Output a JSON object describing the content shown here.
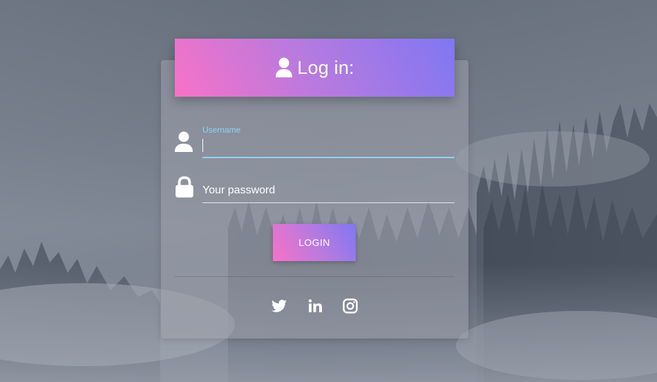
{
  "login_form": {
    "title": "Log in:",
    "header_icon": "user-icon",
    "username": {
      "label": "Username",
      "value": "",
      "icon": "user-icon"
    },
    "password": {
      "placeholder": "Your password",
      "value": "",
      "icon": "lock-icon"
    },
    "submit_label": "LOGIN"
  },
  "social_links": [
    {
      "icon": "twitter-icon"
    },
    {
      "icon": "linkedin-icon"
    },
    {
      "icon": "instagram-icon"
    }
  ],
  "colors": {
    "gradient_start": "#f872c7",
    "gradient_end": "#8077f2",
    "focus_accent": "#8fd3f4"
  }
}
